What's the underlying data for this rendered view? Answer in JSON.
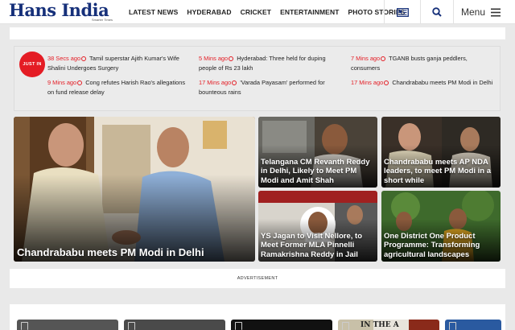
{
  "header": {
    "logo": "Hans India",
    "logo_tagline": "Smarter Times",
    "nav": [
      "LATEST NEWS",
      "HYDERABAD",
      "CRICKET",
      "ENTERTAINMENT",
      "PHOTO STORIES"
    ],
    "epaper_icon": "newspaper-icon",
    "search_icon": "search-icon",
    "menu_label": "Menu"
  },
  "just_in": {
    "badge": "JUST IN",
    "items": [
      {
        "time": "38 Secs ago",
        "text": "Tamil superstar Ajith Kumar's Wife Shalini Undergoes Surgery"
      },
      {
        "time": "5 Mins ago",
        "text": "Hyderabad: Three held for duping people of Rs 23 lakh"
      },
      {
        "time": "7 Mins ago",
        "text": "TGANB busts ganja peddlers, consumers"
      },
      {
        "time": "9 Mins ago",
        "text": "Cong refutes Harish Rao's allegations on fund release delay"
      },
      {
        "time": "17 Mins ago",
        "text": "'Varada Payasam' performed for bounteous rains"
      },
      {
        "time": "17 Mins ago",
        "text": "Chandrababu meets PM Modi in Delhi"
      }
    ]
  },
  "stories": {
    "main": "Chandrababu meets PM Modi in Delhi",
    "s1": "Telangana CM Revanth Reddy in Delhi, Likely to Meet PM Modi and Amit Shah",
    "s2": "Chandrababu meets AP NDA leaders, to meet PM Modi in a short while",
    "s3": "YS Jagan to Visit Nellore, to Meet Former MLA Pinnelli Ramakrishna Reddy in Jail",
    "s4": "One District One Product Programme: Transforming agricultural landscapes"
  },
  "advertisement": "ADVERTISEMENT",
  "bottom_thumb_text": "IN THE A",
  "colors": {
    "brand": "#16307a",
    "accent": "#e41c24"
  }
}
